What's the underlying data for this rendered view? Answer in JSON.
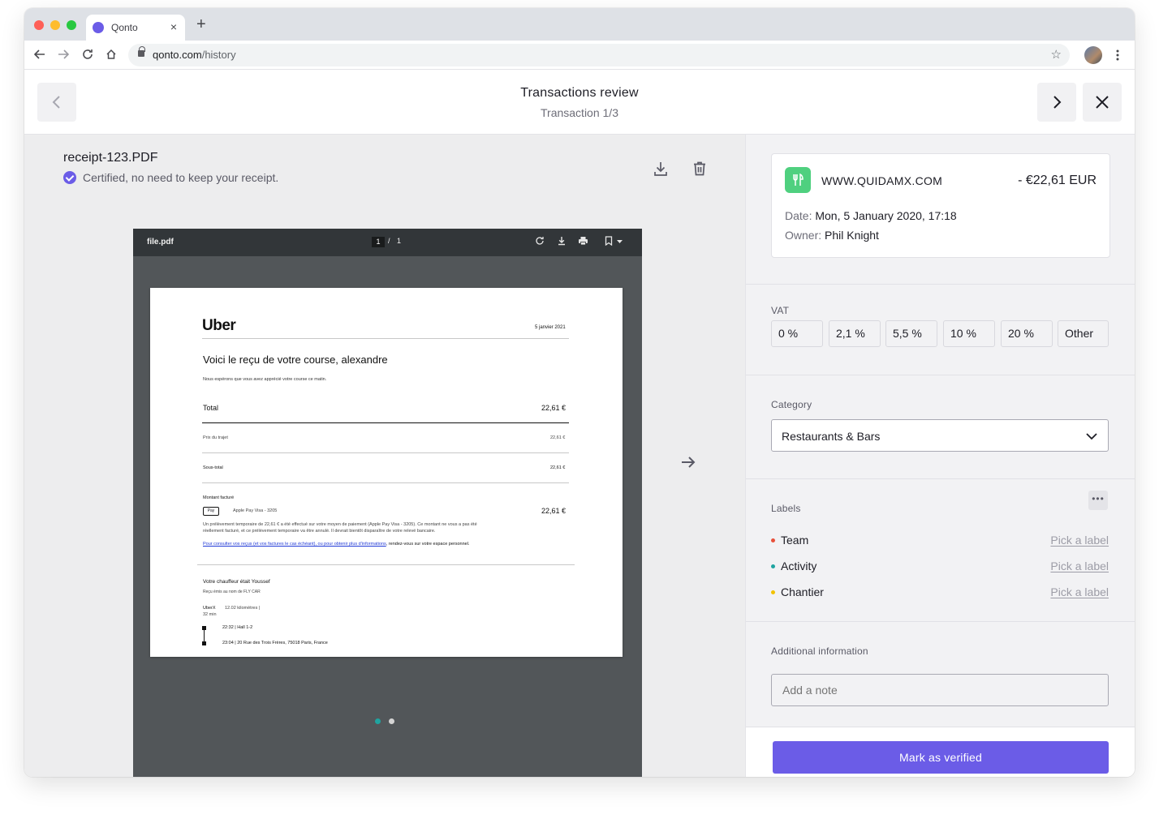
{
  "browser": {
    "tab_title": "Qonto",
    "tab_close": "×",
    "new_tab": "+",
    "url_host": "qonto.com",
    "url_path": "/history"
  },
  "header": {
    "title": "Transactions review",
    "subtitle": "Transaction 1/3"
  },
  "document": {
    "file_name": "receipt-123.PDF",
    "certified_text": "Certified, no need to keep your receipt."
  },
  "pdf_viewer": {
    "file_name": "file.pdf",
    "current_page": "1",
    "separator": "/",
    "total_pages": "1",
    "carousel_active_color": "#1fa4a0",
    "carousel_inactive_color": "#d4d4d4"
  },
  "receipt": {
    "brand": "Uber",
    "date": "5 janvier 2021",
    "heading": "Voici le reçu de votre course, alexandre",
    "subheading": "Nous espérons que vous avez apprécié votre course ce matin.",
    "total_label": "Total",
    "total_value": "22,61 €",
    "trip_price_label": "Prix du trajet",
    "trip_price_value": "22,61 €",
    "subtotal_label": "Sous-total",
    "subtotal_value": "22,61 €",
    "billed_label": "Montant facturé",
    "payment_badge": "Pay",
    "payment_method": "Apple Pay Visa - 3205",
    "billed_value": "22,61 €",
    "notice_line1": "Un prélèvement temporaire de 22,61 € a été effectué sur votre moyen de paiement (Apple Pay Visa - 3205). Ce montant ne vous a pas été",
    "notice_line2": "réellement facturé, et ce prélèvement temporaire va être annulé. Il devrait bientôt disparaître de votre relevé bancaire.",
    "link_text": "Pour consulter vos reçus (et vos factures le cas échéant), ou pour obtenir plus d'informations",
    "link_suffix": ", rendez-vous sur votre espace personnel.",
    "driver_label": "Votre chauffeur était Youssef",
    "issued_for": "Reçu émis au nom de FLY CAR",
    "ride_type": "UberX",
    "ride_distance": "12.02 kilomètres |",
    "ride_duration": "32 min",
    "pickup": "22:32 | Hall 1-2",
    "dropoff": "23:04 | 20 Rue des Trois Frères, 75018 Paris, France"
  },
  "transaction": {
    "merchant": "WWW.QUIDAMX.COM",
    "amount": "- €22,61 EUR",
    "date_label": "Date:",
    "date_value": "Mon, 5 January 2020, 17:18",
    "owner_label": "Owner:",
    "owner_value": "Phil Knight",
    "logo_color": "#4fd07f"
  },
  "vat": {
    "label": "VAT",
    "options": [
      "0 %",
      "2,1 %",
      "5,5 %",
      "10 %",
      "20 %",
      "Other"
    ]
  },
  "category": {
    "label": "Category",
    "selected": "Restaurants & Bars"
  },
  "labels": {
    "label": "Labels",
    "more": "•••",
    "items": [
      {
        "name": "Team",
        "action": "Pick a label",
        "color": "#e8503a"
      },
      {
        "name": "Activity",
        "action": "Pick a label",
        "color": "#1fa4a0"
      },
      {
        "name": "Chantier",
        "action": "Pick a label",
        "color": "#f2c200"
      }
    ]
  },
  "additional": {
    "label": "Additional information",
    "placeholder": "Add a note"
  },
  "footer": {
    "verify_label": "Mark as verified",
    "accent": "#6b5ce7"
  }
}
